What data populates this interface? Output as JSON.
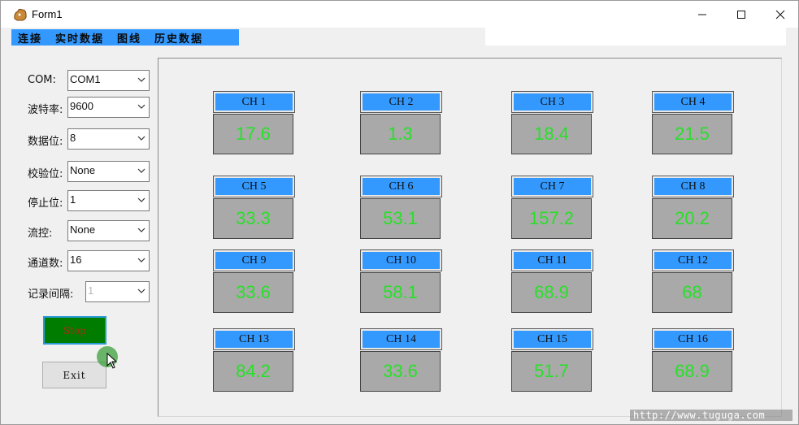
{
  "window": {
    "title": "Form1"
  },
  "menu": {
    "items": [
      "连接",
      "实时数据",
      "图线",
      "历史数据"
    ]
  },
  "settings": [
    {
      "label": "COM:",
      "value": "COM1"
    },
    {
      "label": "波特率:",
      "value": "9600"
    },
    {
      "label": "数据位:",
      "value": "8"
    },
    {
      "label": "校验位:",
      "value": "None"
    },
    {
      "label": "停止位:",
      "value": "1"
    },
    {
      "label": "流控:",
      "value": "None"
    },
    {
      "label": "通道数:",
      "value": "16"
    },
    {
      "label": "记录间隔:",
      "value": "1"
    }
  ],
  "buttons": {
    "start": "Stop",
    "exit": "Exit"
  },
  "channels": [
    {
      "name": "CH 1",
      "value": "17.6"
    },
    {
      "name": "CH 2",
      "value": "1.3"
    },
    {
      "name": "CH 3",
      "value": "18.4"
    },
    {
      "name": "CH 4",
      "value": "21.5"
    },
    {
      "name": "CH 5",
      "value": "33.3"
    },
    {
      "name": "CH 6",
      "value": "53.1"
    },
    {
      "name": "CH 7",
      "value": "157.2"
    },
    {
      "name": "CH 8",
      "value": "20.2"
    },
    {
      "name": "CH 9",
      "value": "33.6"
    },
    {
      "name": "CH 10",
      "value": "58.1"
    },
    {
      "name": "CH 11",
      "value": "68.9"
    },
    {
      "name": "CH 12",
      "value": "68"
    },
    {
      "name": "CH 13",
      "value": "84.2"
    },
    {
      "name": "CH 14",
      "value": "33.6"
    },
    {
      "name": "CH 15",
      "value": "51.7"
    },
    {
      "name": "CH 16",
      "value": "68.9"
    }
  ],
  "watermark": "http://www.tuguga.com",
  "colors": {
    "menu_bg": "#3399ff",
    "channel_label_bg": "#3399ff",
    "value_text": "#28e028",
    "value_bg": "#a9a9a9",
    "start_bg": "#007c00"
  }
}
